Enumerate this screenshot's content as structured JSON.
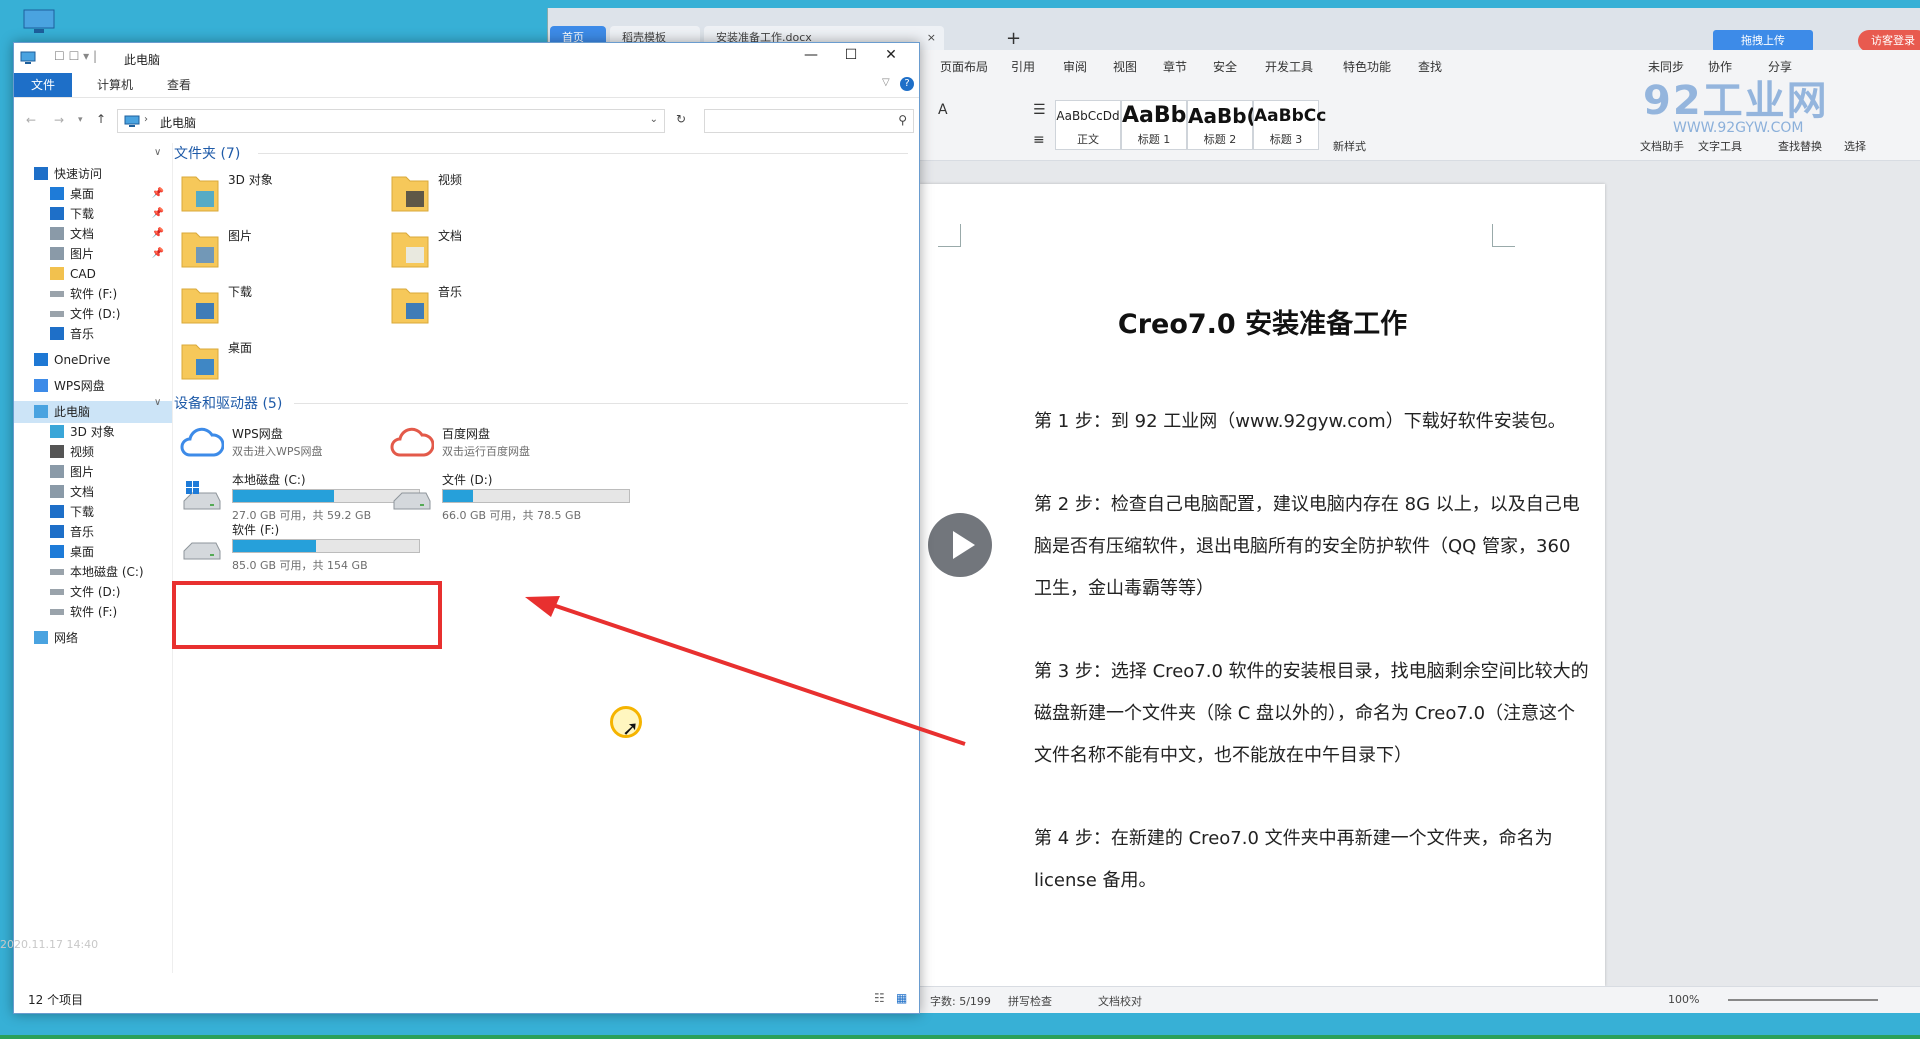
{
  "desktop": {
    "timestamp": "2020.11.17 14:40"
  },
  "wps": {
    "tabs": [
      {
        "label": "首页"
      },
      {
        "label": "稻壳模板"
      },
      {
        "label": "安装准备工作.docx"
      }
    ],
    "upload_label": "拖拽上传",
    "visitor_label": "访客登录",
    "menu": [
      "页面布局",
      "引用",
      "审阅",
      "视图",
      "章节",
      "安全",
      "开发工具",
      "特色功能",
      "查找"
    ],
    "menu_right": [
      "未同步",
      "协作",
      "分享"
    ],
    "styles": [
      {
        "sample": "AaBbCcDd",
        "label": "正文"
      },
      {
        "sample": "AaBb",
        "label": "标题 1"
      },
      {
        "sample": "AaBb(",
        "label": "标题 2"
      },
      {
        "sample": "AaBbCc",
        "label": "标题 3"
      }
    ],
    "ribbon_labels": [
      "新样式",
      "文档助手",
      "文字工具",
      "查找替换",
      "选择"
    ],
    "watermark": "92工业网",
    "watermark_url": "WWW.92GYW.COM",
    "doc": {
      "title": "Creo7.0 安装准备工作",
      "p1": "第 1 步：到 92 工业网（www.92gyw.com）下载好软件安装包。",
      "p2": "第 2 步：检查自己电脑配置，建议电脑内存在 8G 以上，以及自己电脑是否有压缩软件，退出电脑所有的安全防护软件（QQ 管家，360 卫生，金山毒霸等等）",
      "p3": "第 3 步：选择 Creo7.0 软件的安装根目录，找电脑剩余空间比较大的磁盘新建一个文件夹（除 C 盘以外的），命名为 Creo7.0（注意这个文件名称不能有中文，也不能放在中午目录下）",
      "p4": "第 4 步：在新建的 Creo7.0 文件夹中再新建一个文件夹，命名为 license 备用。"
    },
    "status": {
      "wordcount": "字数: 5/199",
      "spell": "拼写检查",
      "proof": "文档校对",
      "zoom": "100%"
    }
  },
  "explorer": {
    "title": "此电脑",
    "ribbon_tabs": [
      "文件",
      "计算机",
      "查看"
    ],
    "address": "此电脑",
    "nav": [
      {
        "label": "快速访问",
        "pinned": false
      },
      {
        "label": "桌面",
        "pinned": true
      },
      {
        "label": "下载",
        "pinned": true
      },
      {
        "label": "文档",
        "pinned": true
      },
      {
        "label": "图片",
        "pinned": true
      },
      {
        "label": "CAD",
        "pinned": false
      },
      {
        "label": "软件 (F:)",
        "pinned": false
      },
      {
        "label": "文件 (D:)",
        "pinned": false
      },
      {
        "label": "音乐",
        "pinned": false
      },
      {
        "label": "OneDrive",
        "pinned": false
      },
      {
        "label": "WPS网盘",
        "pinned": false
      },
      {
        "label": "此电脑",
        "pinned": false
      },
      {
        "label": "3D 对象",
        "pinned": false
      },
      {
        "label": "视频",
        "pinned": false
      },
      {
        "label": "图片",
        "pinned": false
      },
      {
        "label": "文档",
        "pinned": false
      },
      {
        "label": "下载",
        "pinned": false
      },
      {
        "label": "音乐",
        "pinned": false
      },
      {
        "label": "桌面",
        "pinned": false
      },
      {
        "label": "本地磁盘 (C:)",
        "pinned": false
      },
      {
        "label": "文件 (D:)",
        "pinned": false
      },
      {
        "label": "软件 (F:)",
        "pinned": false
      },
      {
        "label": "网络",
        "pinned": false
      }
    ],
    "folders_header": "文件夹 (7)",
    "folders": [
      "3D 对象",
      "视频",
      "图片",
      "文档",
      "下载",
      "音乐",
      "桌面"
    ],
    "devices_header": "设备和驱动器 (5)",
    "clouds": [
      {
        "name": "WPS网盘",
        "desc": "双击进入WPS网盘"
      },
      {
        "name": "百度网盘",
        "desc": "双击运行百度网盘"
      }
    ],
    "drives": [
      {
        "name": "本地磁盘 (C:)",
        "detail": "27.0 GB 可用，共 59.2 GB",
        "used_fraction": 0.544
      },
      {
        "name": "文件 (D:)",
        "detail": "66.0 GB 可用，共 78.5 GB",
        "used_fraction": 0.159
      },
      {
        "name": "软件 (F:)",
        "detail": "85.0 GB 可用，共 154 GB",
        "used_fraction": 0.448
      }
    ],
    "status": "12 个项目"
  }
}
